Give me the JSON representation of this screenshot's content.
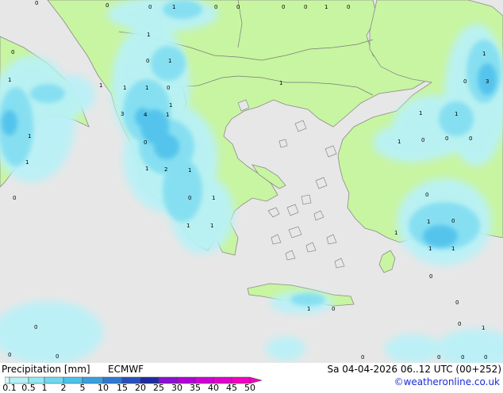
{
  "header": {
    "title": "Precipitation [mm]",
    "model": "ECMWF",
    "run_info": "Sa 04-04-2026 06..12 UTC (00+252)",
    "copyright": "©weatheronline.co.uk"
  },
  "legend": {
    "labels": [
      "0.1",
      "0.5",
      "1",
      "2",
      "5",
      "10",
      "15",
      "20",
      "25",
      "30",
      "35",
      "40",
      "45",
      "50"
    ],
    "colors": [
      "#d5f8fa",
      "#b4f1f6",
      "#92e8f2",
      "#6fd8ef",
      "#4dc1ea",
      "#3a9fdf",
      "#2f78d2",
      "#2850bd",
      "#1d2ba0",
      "#8a0fd1",
      "#b000d8",
      "#cf00d3",
      "#e000cb",
      "#f000c0"
    ]
  },
  "map": {
    "colors": {
      "sea": "#e7e7e7",
      "land_no_precip": "#c8f5a1",
      "precip_light": "#b9f1f7",
      "precip_mid": "#86dff1",
      "precip_heavy": "#55c4ec",
      "coast": "#8a8a8a"
    },
    "precip_values": [
      "0",
      "0",
      "1",
      "0",
      "0",
      "0",
      "0",
      "1",
      "0",
      "1",
      "0",
      "1",
      "0",
      "1",
      "1",
      "0",
      "1",
      "1",
      "1",
      "0",
      "3",
      "1",
      "4",
      "1",
      "1",
      "3",
      "1",
      "1",
      "2",
      "1",
      "0",
      "1",
      "1",
      "1",
      "1",
      "1",
      "1",
      "0",
      "0",
      "1",
      "0",
      "0",
      "0",
      "0",
      "1",
      "1",
      "1",
      "0",
      "1",
      "1",
      "0",
      "0",
      "0",
      "0",
      "1",
      "0",
      "0",
      "0",
      "0",
      "0",
      "0",
      "0",
      "0"
    ]
  }
}
